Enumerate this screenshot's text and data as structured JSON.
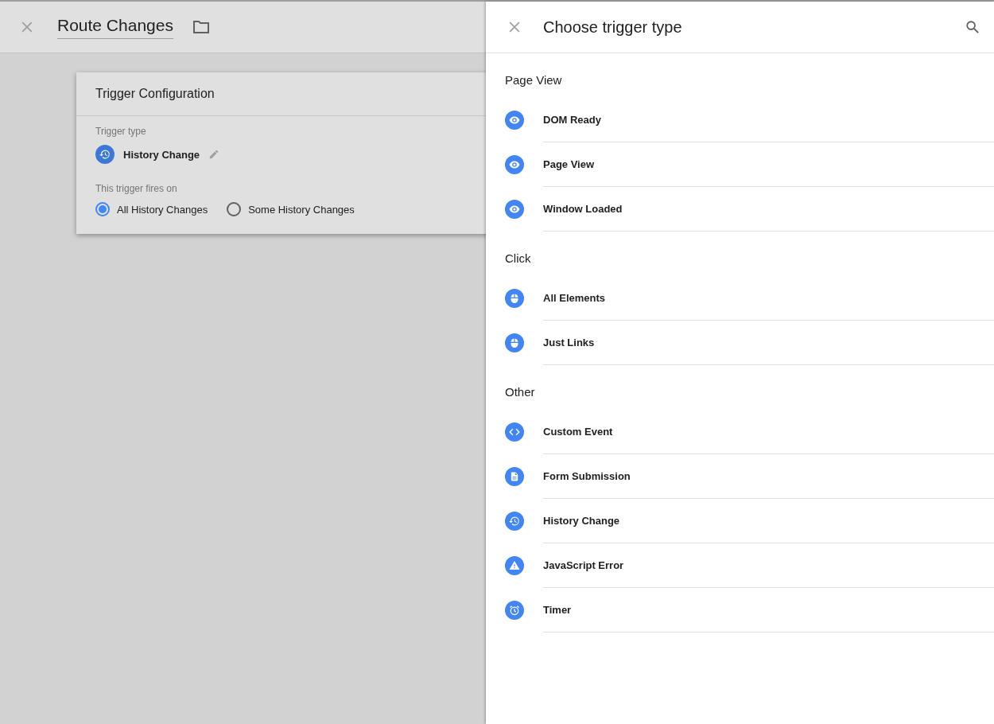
{
  "header": {
    "title": "Route Changes"
  },
  "card": {
    "title": "Trigger Configuration",
    "trigger_type_label": "Trigger type",
    "trigger_type": {
      "name": "History Change",
      "kind": "history"
    },
    "fires_on_label": "This trigger fires on",
    "options": [
      {
        "label": "All History Changes",
        "selected": true
      },
      {
        "label": "Some History Changes",
        "selected": false
      }
    ]
  },
  "panel": {
    "title": "Choose trigger type",
    "sections": [
      {
        "title": "Page View",
        "items": [
          {
            "label": "DOM Ready",
            "kind": "eye"
          },
          {
            "label": "Page View",
            "kind": "eye"
          },
          {
            "label": "Window Loaded",
            "kind": "eye"
          }
        ]
      },
      {
        "title": "Click",
        "items": [
          {
            "label": "All Elements",
            "kind": "mouse"
          },
          {
            "label": "Just Links",
            "kind": "mouse"
          }
        ]
      },
      {
        "title": "Other",
        "items": [
          {
            "label": "Custom Event",
            "kind": "code"
          },
          {
            "label": "Form Submission",
            "kind": "form"
          },
          {
            "label": "History Change",
            "kind": "history"
          },
          {
            "label": "JavaScript Error",
            "kind": "warning"
          },
          {
            "label": "Timer",
            "kind": "timer"
          }
        ]
      }
    ]
  }
}
